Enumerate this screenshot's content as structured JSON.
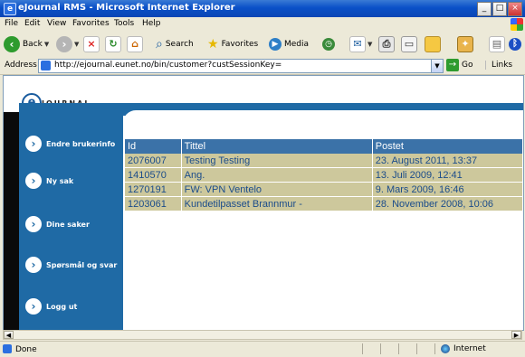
{
  "window": {
    "title": "eJournal RMS - Microsoft Internet Explorer",
    "controls": [
      "_",
      "□",
      "×"
    ]
  },
  "menu": [
    "File",
    "Edit",
    "View",
    "Favorites",
    "Tools",
    "Help"
  ],
  "toolbar": {
    "back": "Back",
    "search": "Search",
    "favorites": "Favorites",
    "media": "Media"
  },
  "address": {
    "label": "Address",
    "url": "http://ejournal.eunet.no/bin/customer?custSessionKey=",
    "go": "Go",
    "links": "Links"
  },
  "brand": {
    "logo_letter": "e",
    "logo_text": "JOURNAL"
  },
  "nav": [
    {
      "label": "Endre brukerinfo"
    },
    {
      "label": "Ny sak"
    },
    {
      "label": "Dine saker"
    },
    {
      "label": "Spørsmål og svar"
    },
    {
      "label": "Logg ut"
    }
  ],
  "table": {
    "headers": [
      "Id",
      "Tittel",
      "Postet"
    ],
    "rows": [
      [
        "2076007",
        "Testing Testing",
        "23. August 2011, 13:37"
      ],
      [
        "1410570",
        "Ang.",
        "13. Juli 2009, 12:41"
      ],
      [
        "1270191",
        "FW: VPN Ventelo",
        "9. Mars 2009, 16:46"
      ],
      [
        "1203061",
        "Kundetilpasset Brannmur -",
        "28. November 2008, 10:06"
      ]
    ]
  },
  "status": {
    "text": "Done",
    "zone": "Internet"
  },
  "colors": {
    "nav_blue": "#1f6aa5",
    "header_blue": "#3b72a8",
    "row_khaki": "#cdc89c",
    "row_text": "#1b4c8a"
  }
}
